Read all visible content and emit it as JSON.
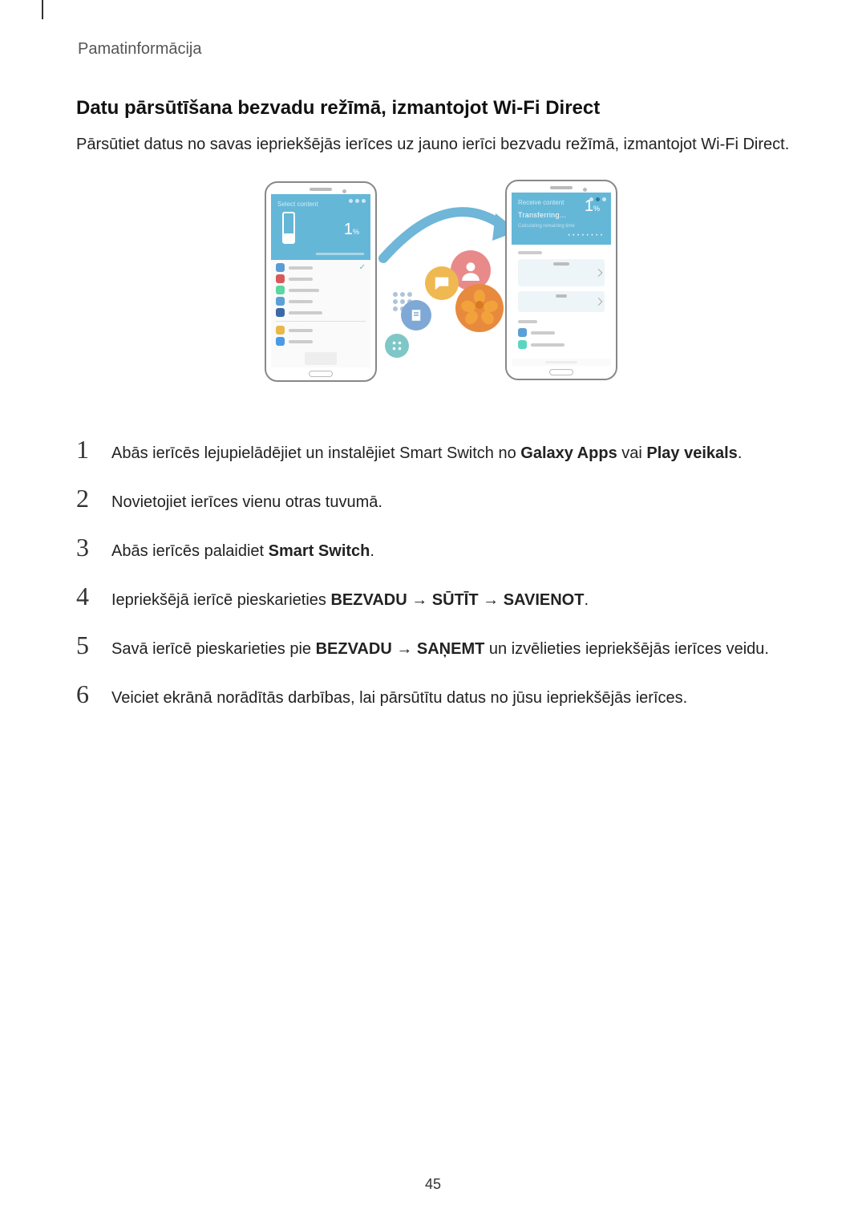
{
  "header": "Pamatinformācija",
  "section_title": "Datu pārsūtīšana bezvadu režīmā, izmantojot Wi-Fi Direct",
  "intro": "Pārsūtiet datus no savas iepriekšējās ierīces uz jauno ierīci bezvadu režīmā, izmantojot Wi-Fi Direct.",
  "figure": {
    "left_phone": {
      "percent": "1",
      "percent_suffix": "%"
    },
    "right_phone": {
      "title": "Transferring...",
      "subtitle": "Calculating remaining time",
      "percent": "1",
      "percent_suffix": "%"
    }
  },
  "steps": [
    {
      "num": "1",
      "parts": [
        "Abās ierīcēs lejupielādējiet un instalējiet Smart Switch no ",
        {
          "b": "Galaxy Apps"
        },
        " vai ",
        {
          "b": "Play veikals"
        },
        "."
      ]
    },
    {
      "num": "2",
      "parts": [
        "Novietojiet ierīces vienu otras tuvumā."
      ]
    },
    {
      "num": "3",
      "parts": [
        "Abās ierīcēs palaidiet ",
        {
          "b": "Smart Switch"
        },
        "."
      ]
    },
    {
      "num": "4",
      "parts": [
        "Iepriekšējā ierīcē pieskarieties ",
        {
          "b": "BEZVADU"
        },
        " → ",
        {
          "b": "SŪTĪT"
        },
        " → ",
        {
          "b": "SAVIENOT"
        },
        "."
      ]
    },
    {
      "num": "5",
      "parts": [
        "Savā ierīcē pieskarieties pie ",
        {
          "b": "BEZVADU"
        },
        " → ",
        {
          "b": "SAŅEMT"
        },
        " un izvēlieties iepriekšējās ierīces veidu."
      ]
    },
    {
      "num": "6",
      "parts": [
        "Veiciet ekrānā norādītās darbības, lai pārsūtītu datus no jūsu iepriekšējās ierīces."
      ]
    }
  ],
  "page_number": "45"
}
